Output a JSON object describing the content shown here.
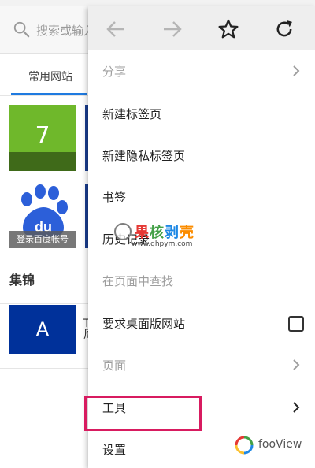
{
  "background": {
    "search_placeholder": "搜索或输入",
    "tab_label": "常用网站",
    "tile_number": "7",
    "baidu_logo_text": "du",
    "baidu_caption": "登录百度帐号",
    "section_title": "集锦",
    "tile_letter": "A",
    "peek_text": "T 周"
  },
  "menu": {
    "toolbar": {
      "back_icon": "arrow-left-icon",
      "forward_icon": "arrow-right-icon",
      "bookmark_icon": "star-outline-icon",
      "reload_icon": "reload-icon"
    },
    "items": [
      {
        "label": "分享",
        "disabled": true,
        "has_arrow": true
      },
      {
        "label": "新建标签页"
      },
      {
        "label": "新建隐私标签页"
      },
      {
        "label": "书签"
      },
      {
        "label": "历史记录"
      },
      {
        "label": "在页面中查找",
        "disabled": true
      },
      {
        "label": "要求桌面版网站",
        "has_checkbox": true,
        "checked": false
      },
      {
        "label": "页面",
        "disabled": true,
        "has_arrow": true
      },
      {
        "label": "工具",
        "has_arrow": true,
        "highlighted": true
      },
      {
        "label": "设置"
      }
    ]
  },
  "watermark": {
    "text": "果核剥壳",
    "url": "www.ghpym.com"
  },
  "brand": {
    "name": "fooView"
  },
  "colors": {
    "accent_blue": "#1f7ae0",
    "highlight": "#d81b60",
    "toolbar_bg": "#eeeeee"
  }
}
